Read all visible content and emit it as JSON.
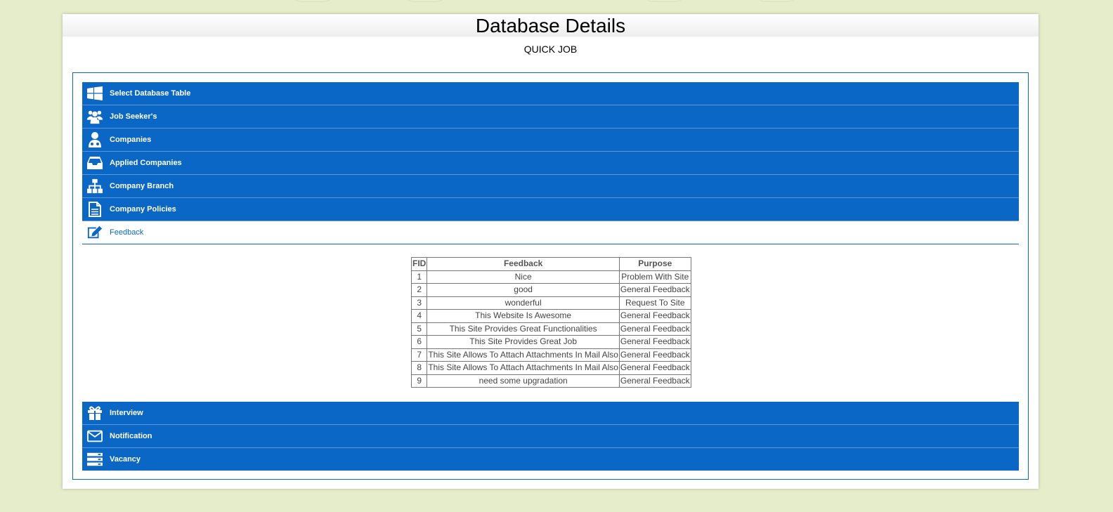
{
  "page": {
    "title": "Database Details",
    "subtitle": "QUICK JOB"
  },
  "accordion": {
    "top_items": [
      {
        "label": "Select Database Table",
        "icon": "windows-icon"
      },
      {
        "label": "Job Seeker's",
        "icon": "users-group-icon"
      },
      {
        "label": "Companies",
        "icon": "user-person-icon"
      },
      {
        "label": "Applied Companies",
        "icon": "inbox-tray-icon"
      },
      {
        "label": "Company Branch",
        "icon": "sitemap-icon"
      },
      {
        "label": "Company Policies",
        "icon": "document-icon"
      }
    ],
    "open_item": {
      "label": "Feedback",
      "icon": "edit-pencil-icon"
    },
    "bottom_items": [
      {
        "label": "Interview",
        "icon": "gift-icon"
      },
      {
        "label": "Notification",
        "icon": "envelope-icon"
      },
      {
        "label": "Vacancy",
        "icon": "server-icon"
      }
    ]
  },
  "feedback_table": {
    "headers": [
      "FID",
      "Feedback",
      "Purpose"
    ],
    "rows": [
      [
        "1",
        "Nice",
        "Problem With Site"
      ],
      [
        "2",
        "good",
        "General Feedback"
      ],
      [
        "3",
        "wonderful",
        "Request To Site"
      ],
      [
        "4",
        "This Website Is Awesome",
        "General Feedback"
      ],
      [
        "5",
        "This Site Provides Great Functionalities",
        "General Feedback"
      ],
      [
        "6",
        "This Site Provides Great Job",
        "General Feedback"
      ],
      [
        "7",
        "This Site Allows To Attach Attachments In Mail Also",
        "General Feedback"
      ],
      [
        "8",
        "This Site Allows To Attach Attachments In Mail Also",
        "General Feedback"
      ],
      [
        "9",
        "need some upgradation",
        "General Feedback"
      ]
    ]
  },
  "colors": {
    "accent": "#0b67c6",
    "background": "#e6edcb"
  }
}
